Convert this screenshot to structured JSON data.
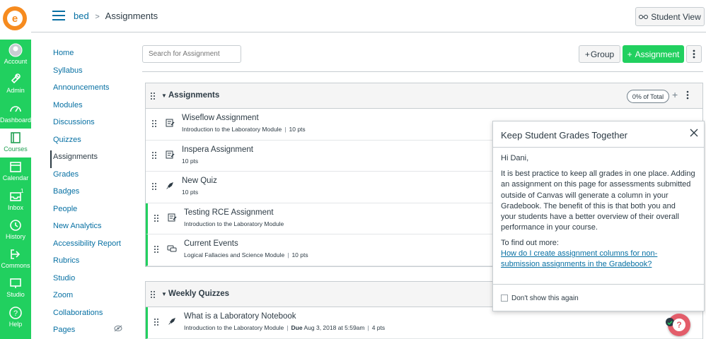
{
  "global_nav": {
    "items": [
      {
        "label": "Account",
        "icon": "account-icon"
      },
      {
        "label": "Admin",
        "icon": "admin-icon"
      },
      {
        "label": "Dashboard",
        "icon": "dashboard-icon"
      },
      {
        "label": "Courses",
        "icon": "courses-icon"
      },
      {
        "label": "Calendar",
        "icon": "calendar-icon"
      },
      {
        "label": "Inbox",
        "icon": "inbox-icon",
        "badge": "1"
      },
      {
        "label": "History",
        "icon": "history-icon"
      },
      {
        "label": "Commons",
        "icon": "commons-icon"
      },
      {
        "label": "Studio",
        "icon": "studio-icon"
      },
      {
        "label": "Help",
        "icon": "help-icon"
      }
    ],
    "active": "Courses",
    "colors": {
      "nav_bg": "#21d05f",
      "active_text": "#21a053",
      "logo": "#f68b1f"
    }
  },
  "header": {
    "course": "bed",
    "page": "Assignments",
    "student_view_label": "Student View"
  },
  "course_nav": {
    "items": [
      "Home",
      "Syllabus",
      "Announcements",
      "Modules",
      "Discussions",
      "Quizzes",
      "Assignments",
      "Grades",
      "Badges",
      "People",
      "New Analytics",
      "Accessibility Report",
      "Rubrics",
      "Studio",
      "Zoom",
      "Collaborations",
      "Pages"
    ],
    "active": "Assignments"
  },
  "toolbar": {
    "search_placeholder": "Search for Assignment",
    "group_label": "Group",
    "assignment_label": "Assignment",
    "plus": "+"
  },
  "groups": [
    {
      "title": "Assignments",
      "percent": "0% of Total",
      "items": [
        {
          "title": "Wiseflow Assignment",
          "module": "Introduction to the Laboratory Module",
          "points": "10 pts",
          "published": false,
          "icon": "assignment-icon"
        },
        {
          "title": "Inspera Assignment",
          "module": "",
          "points": "10 pts",
          "published": false,
          "icon": "assignment-icon"
        },
        {
          "title": "New Quiz",
          "module": "",
          "points": "10 pts",
          "published": false,
          "icon": "quiz-rocket-icon"
        },
        {
          "title": "Testing RCE Assignment",
          "module": "Introduction to the Laboratory Module",
          "points": "",
          "published": true,
          "icon": "assignment-icon"
        },
        {
          "title": "Current Events",
          "module": "Logical Fallacies and Science Module",
          "points": "10 pts",
          "published": true,
          "icon": "discussion-icon"
        }
      ]
    },
    {
      "title": "Weekly Quizzes",
      "items": [
        {
          "title": "What is a Laboratory Notebook",
          "module": "Introduction to the Laboratory Module",
          "due_label": "Due",
          "due": "Aug 3, 2018 at 5:59am",
          "points": "4 pts",
          "published": true,
          "icon": "quiz-rocket-icon"
        }
      ]
    }
  ],
  "popover": {
    "title": "Keep Student Grades Together",
    "greeting": "Hi Dani,",
    "body_lines": [
      "It is best practice to keep all grades in one place. Adding",
      "an assignment on this page for assessments submitted",
      "outside of Canvas will generate a column in your",
      "Gradebook. The benefit of this is that both you and",
      "your students have a better overview of their overall",
      "performance in your course."
    ],
    "more_label": "To find out more:",
    "link_lines": [
      "How do I create assignment columns for non-",
      "submission assignments in the Gradebook?"
    ],
    "checkbox_label": "Don't show this again"
  },
  "help_bubble": {
    "label": "?"
  }
}
